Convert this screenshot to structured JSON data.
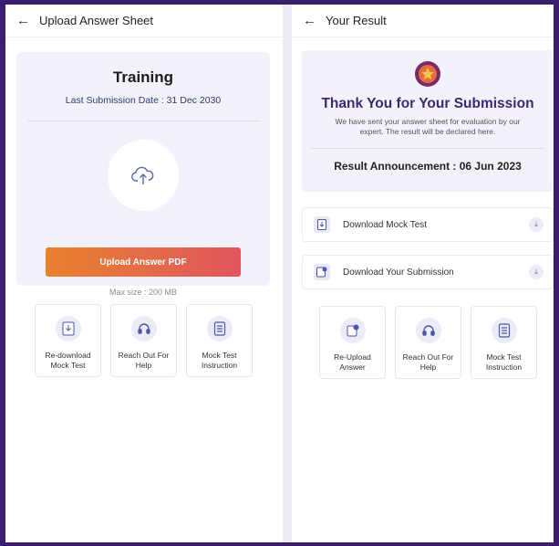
{
  "left": {
    "header_title": "Upload Answer Sheet",
    "card_title": "Training",
    "submission_date": "Last Submission Date : 31 Dec 2030",
    "upload_button": "Upload Answer PDF",
    "max_size": "Max size : 200 MB",
    "tiles": [
      {
        "label": "Re-download Mock Test",
        "icon": "download-doc-icon"
      },
      {
        "label": "Reach Out For Help",
        "icon": "headset-icon"
      },
      {
        "label": "Mock Test Instruction",
        "icon": "document-list-icon"
      }
    ]
  },
  "right": {
    "header_title": "Your Result",
    "thanks_title": "Thank You for Your Submission",
    "thanks_text": "We have sent your answer sheet for evaluation by our expert. The result will be declared here.",
    "announcement": "Result Announcement : 06 Jun 2023",
    "rows": [
      {
        "label": "Download Mock Test",
        "icon": "document-download-icon"
      },
      {
        "label": "Download Your Submission",
        "icon": "submission-icon"
      }
    ],
    "tiles": [
      {
        "label": "Re-Upload Answer",
        "icon": "reupload-icon"
      },
      {
        "label": "Reach Out For Help",
        "icon": "headset-icon"
      },
      {
        "label": "Mock Test Instruction",
        "icon": "document-list-icon"
      }
    ]
  },
  "colors": {
    "frame": "#3b1f6e",
    "accent": "#3c2871",
    "button_start": "#e9812e",
    "button_end": "#e0565f"
  }
}
